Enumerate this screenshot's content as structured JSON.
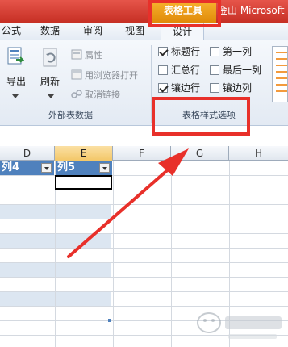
{
  "titlebar": {
    "context_tab": "表格工具",
    "app_title": "金山 Microsoft"
  },
  "tabs": [
    {
      "label": "公式"
    },
    {
      "label": "数据"
    },
    {
      "label": "审阅"
    },
    {
      "label": "视图"
    },
    {
      "label": "设计",
      "active": true
    }
  ],
  "ribbon": {
    "export_label": "导出",
    "refresh_label": "刷新",
    "properties_label": "属性",
    "open_in_browser_label": "用浏览器打开",
    "unlink_label": "取消链接",
    "external_group_label": "外部表数据",
    "style_options_group_label": "表格样式选项",
    "options": [
      {
        "label": "标题行",
        "checked": true
      },
      {
        "label": "汇总行",
        "checked": false
      },
      {
        "label": "镶边行",
        "checked": true
      },
      {
        "label": "第一列",
        "checked": false
      },
      {
        "label": "最后一列",
        "checked": false
      },
      {
        "label": "镶边列",
        "checked": false
      }
    ]
  },
  "sheet": {
    "columns": [
      "D",
      "E",
      "F",
      "G",
      "H"
    ],
    "selected_column": "E",
    "table_headers": [
      "列4",
      "列5"
    ]
  },
  "colors": {
    "accent_red": "#e8302a",
    "table_header_blue": "#4f81bd",
    "band_blue": "#dce6f1"
  }
}
